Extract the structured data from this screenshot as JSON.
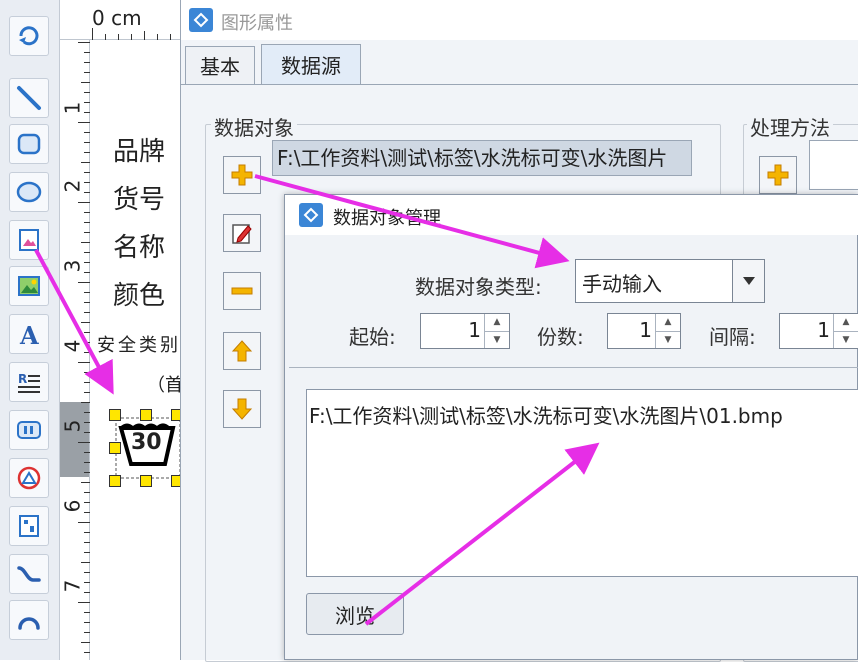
{
  "toolbar": {
    "tools": [
      {
        "name": "refresh-tool",
        "icon": "refresh-icon"
      },
      {
        "name": "line-tool",
        "icon": "line-icon"
      },
      {
        "name": "rounded-rectangle-tool",
        "icon": "rounded-rectangle-icon"
      },
      {
        "name": "ellipse-tool",
        "icon": "ellipse-icon"
      },
      {
        "name": "image-tool",
        "icon": "image-icon"
      },
      {
        "name": "picture-tool",
        "icon": "picture-icon"
      },
      {
        "name": "text-tool",
        "icon": "text-icon"
      },
      {
        "name": "rich-text-tool",
        "icon": "rich-text-icon"
      },
      {
        "name": "barcode-tool",
        "icon": "barcode-icon"
      },
      {
        "name": "shape-tool",
        "icon": "shape-icon"
      },
      {
        "name": "qr-tool",
        "icon": "qr-icon"
      },
      {
        "name": "curve-tool",
        "icon": "curve-icon"
      },
      {
        "name": "arc-tool",
        "icon": "arc-icon"
      }
    ]
  },
  "ruler": {
    "unit": "0 cm",
    "marks": [
      "1",
      "2",
      "3",
      "4",
      "5",
      "6",
      "7"
    ]
  },
  "canvas": {
    "labels": [
      "品牌",
      "货号",
      "名称",
      "颜色"
    ],
    "safety_text": "安全类别",
    "paren_text": "（首",
    "wash_symbol_value": "30"
  },
  "property_window": {
    "title": "图形属性",
    "tabs": [
      "基本",
      "数据源"
    ],
    "active_tab": "数据源",
    "data_object_group": "数据对象",
    "process_group": "处理方法",
    "data_object_path": "F:\\工作资料\\测试\\标签\\水洗标可变\\水洗图片"
  },
  "dialog": {
    "title": "数据对象管理",
    "type_label": "数据对象类型:",
    "type_value": "手动输入",
    "start_label": "起始:",
    "start_value": "1",
    "copies_label": "份数:",
    "copies_value": "1",
    "interval_label": "间隔:",
    "interval_value": "1",
    "content": "F:\\工作资料\\测试\\标签\\水洗标可变\\水洗图片\\01.bmp",
    "browse_label": "浏览"
  },
  "colors": {
    "annotation_arrow": "#e62ee6",
    "handle": "#ffe600",
    "path_field_bg": "#cfd8e3"
  }
}
